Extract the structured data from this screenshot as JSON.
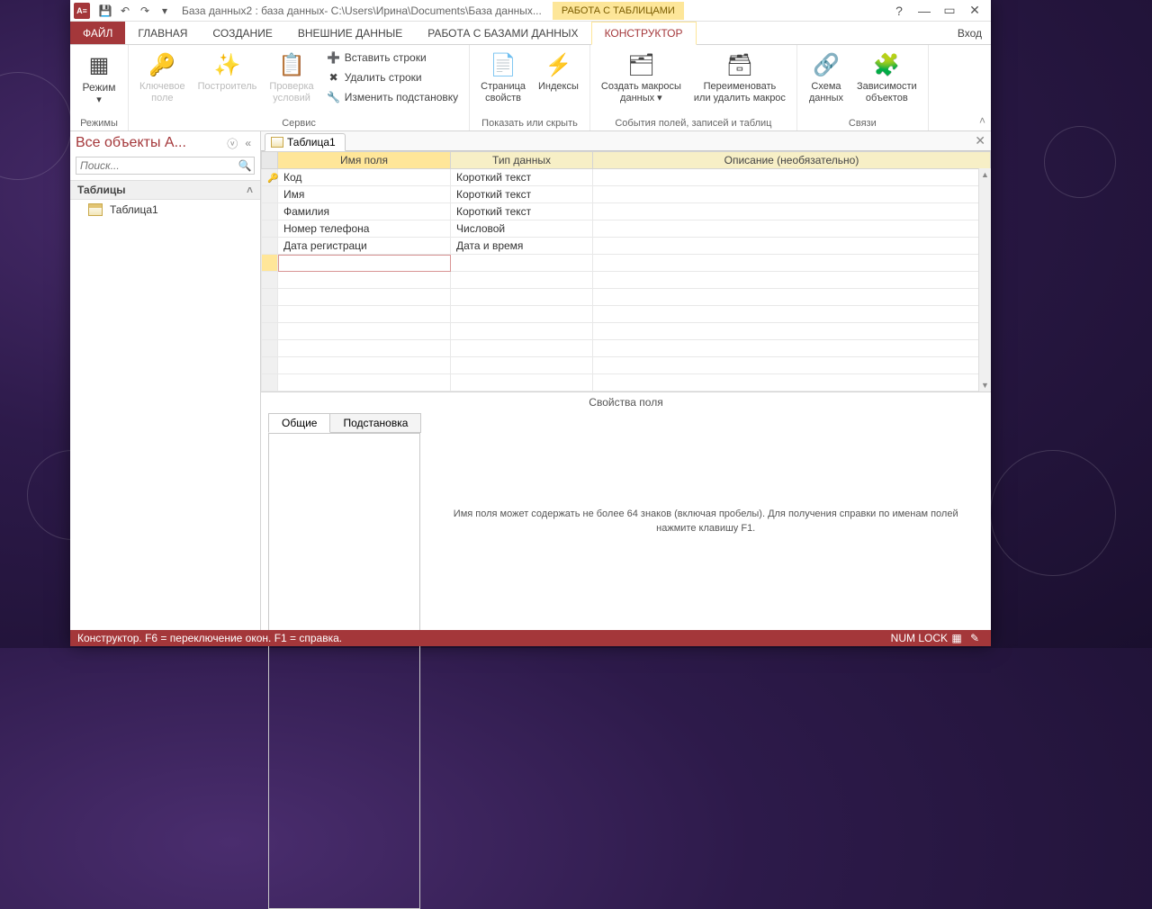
{
  "titlebar": {
    "app_icon": "A≡",
    "title": "База данных2 : база данных- C:\\Users\\Ирина\\Documents\\База данных...",
    "context_title": "РАБОТА С ТАБЛИЦАМИ",
    "signin": "Вход"
  },
  "tabs": {
    "file": "ФАЙЛ",
    "home": "ГЛАВНАЯ",
    "create": "СОЗДАНИЕ",
    "extdata": "ВНЕШНИЕ ДАННЫЕ",
    "dbtools": "РАБОТА С БАЗАМИ ДАННЫХ",
    "design": "КОНСТРУКТОР"
  },
  "ribbon": {
    "modes": {
      "view": "Режим",
      "group": "Режимы"
    },
    "service": {
      "primary_key": "Ключевое\nполе",
      "builder": "Построитель",
      "validation": "Проверка\nусловий",
      "insert_rows": "Вставить строки",
      "delete_rows": "Удалить строки",
      "modify_lookup": "Изменить подстановку",
      "group": "Сервис"
    },
    "show_hide": {
      "property_sheet": "Страница\nсвойств",
      "indexes": "Индексы",
      "group": "Показать или скрыть"
    },
    "events": {
      "create_macros": "Создать макросы\nданных ▾",
      "rename_delete": "Переименовать\nили удалить макрос",
      "group": "События полей, записей и таблиц"
    },
    "relations": {
      "schema": "Схема\nданных",
      "deps": "Зависимости\nобъектов",
      "group": "Связи"
    }
  },
  "nav": {
    "title": "Все объекты A...",
    "search_placeholder": "Поиск...",
    "group_tables": "Таблицы",
    "item1": "Таблица1"
  },
  "doc": {
    "tab1": "Таблица1"
  },
  "grid": {
    "col_name": "Имя поля",
    "col_type": "Тип данных",
    "col_desc": "Описание (необязательно)",
    "rows": [
      {
        "name": "Код",
        "type": "Короткий текст",
        "desc": "",
        "pk": true
      },
      {
        "name": "Имя",
        "type": "Короткий текст",
        "desc": ""
      },
      {
        "name": "Фамилия",
        "type": "Короткий текст",
        "desc": ""
      },
      {
        "name": "Номер телефона",
        "type": "Числовой",
        "desc": ""
      },
      {
        "name": "Дата регистраци",
        "type": "Дата и время",
        "desc": ""
      }
    ]
  },
  "props": {
    "title": "Свойства поля",
    "tab_general": "Общие",
    "tab_lookup": "Подстановка",
    "help": "Имя поля может содержать не более 64 знаков (включая пробелы). Для получения справки по именам полей нажмите клавишу F1."
  },
  "status": {
    "left": "Конструктор.  F6 = переключение окон.  F1 = справка.",
    "numlock": "NUM LOCK"
  }
}
